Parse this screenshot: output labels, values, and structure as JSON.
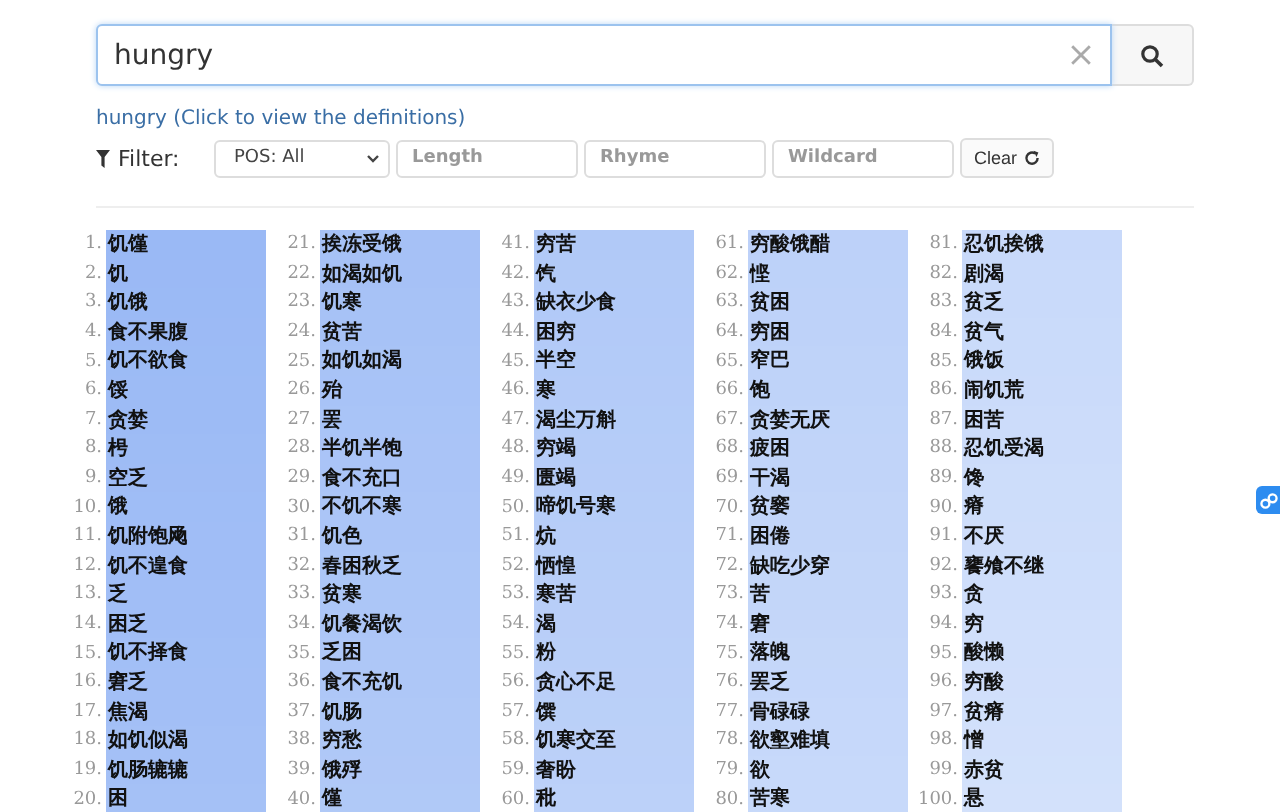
{
  "search": {
    "value": "hungry"
  },
  "definitions_link": "hungry (Click to view the definitions)",
  "filter": {
    "label": "Filter:",
    "pos": "POS: All",
    "fields": [
      {
        "placeholder": "Length"
      },
      {
        "placeholder": "Rhyme"
      },
      {
        "placeholder": "Wildcard"
      }
    ],
    "clear_button": "Clear"
  },
  "results": [
    {
      "number": "1.",
      "word": "饥馑"
    },
    {
      "number": "2.",
      "word": "饥"
    },
    {
      "number": "3.",
      "word": "饥饿"
    },
    {
      "number": "4.",
      "word": "食不果腹"
    },
    {
      "number": "5.",
      "word": "饥不欲食"
    },
    {
      "number": "6.",
      "word": "馁"
    },
    {
      "number": "7.",
      "word": "贪婪"
    },
    {
      "number": "8.",
      "word": "枵"
    },
    {
      "number": "9.",
      "word": "空乏"
    },
    {
      "number": "10.",
      "word": "饿"
    },
    {
      "number": "11.",
      "word": "饥附饱飏"
    },
    {
      "number": "12.",
      "word": "饥不遑食"
    },
    {
      "number": "13.",
      "word": "乏"
    },
    {
      "number": "14.",
      "word": "困乏"
    },
    {
      "number": "15.",
      "word": "饥不择食"
    },
    {
      "number": "16.",
      "word": "窘乏"
    },
    {
      "number": "17.",
      "word": "焦渴"
    },
    {
      "number": "18.",
      "word": "如饥似渴"
    },
    {
      "number": "19.",
      "word": "饥肠辘辘"
    },
    {
      "number": "20.",
      "word": "困"
    },
    {
      "number": "21.",
      "word": "挨冻受饿"
    },
    {
      "number": "22.",
      "word": "如渴如饥"
    },
    {
      "number": "23.",
      "word": "饥寒"
    },
    {
      "number": "24.",
      "word": "贫苦"
    },
    {
      "number": "25.",
      "word": "如饥如渴"
    },
    {
      "number": "26.",
      "word": "殆"
    },
    {
      "number": "27.",
      "word": "罢"
    },
    {
      "number": "28.",
      "word": "半饥半饱"
    },
    {
      "number": "29.",
      "word": "食不充口"
    },
    {
      "number": "30.",
      "word": "不饥不寒"
    },
    {
      "number": "31.",
      "word": "饥色"
    },
    {
      "number": "32.",
      "word": "春困秋乏"
    },
    {
      "number": "33.",
      "word": "贫寒"
    },
    {
      "number": "34.",
      "word": "饥餐渴饮"
    },
    {
      "number": "35.",
      "word": "乏困"
    },
    {
      "number": "36.",
      "word": "食不充饥"
    },
    {
      "number": "37.",
      "word": "饥肠"
    },
    {
      "number": "38.",
      "word": "穷愁"
    },
    {
      "number": "39.",
      "word": "饿殍"
    },
    {
      "number": "40.",
      "word": "馑"
    },
    {
      "number": "41.",
      "word": "穷苦"
    },
    {
      "number": "42.",
      "word": "饩"
    },
    {
      "number": "43.",
      "word": "缺衣少食"
    },
    {
      "number": "44.",
      "word": "困穷"
    },
    {
      "number": "45.",
      "word": "半空"
    },
    {
      "number": "46.",
      "word": "寒"
    },
    {
      "number": "47.",
      "word": "渴尘万斛"
    },
    {
      "number": "48.",
      "word": "穷竭"
    },
    {
      "number": "49.",
      "word": "匮竭"
    },
    {
      "number": "50.",
      "word": "啼饥号寒"
    },
    {
      "number": "51.",
      "word": "炕"
    },
    {
      "number": "52.",
      "word": "恓惶"
    },
    {
      "number": "53.",
      "word": "寒苦"
    },
    {
      "number": "54.",
      "word": "渴"
    },
    {
      "number": "55.",
      "word": "粉"
    },
    {
      "number": "56.",
      "word": "贪心不足"
    },
    {
      "number": "57.",
      "word": "馔"
    },
    {
      "number": "58.",
      "word": "饥寒交至"
    },
    {
      "number": "59.",
      "word": "奢盼"
    },
    {
      "number": "60.",
      "word": "秕"
    },
    {
      "number": "61.",
      "word": "穷酸饿醋"
    },
    {
      "number": "62.",
      "word": "悭"
    },
    {
      "number": "63.",
      "word": "贫困"
    },
    {
      "number": "64.",
      "word": "穷困"
    },
    {
      "number": "65.",
      "word": "窄巴"
    },
    {
      "number": "66.",
      "word": "饱"
    },
    {
      "number": "67.",
      "word": "贪婪无厌"
    },
    {
      "number": "68.",
      "word": "疲困"
    },
    {
      "number": "69.",
      "word": "干渴"
    },
    {
      "number": "70.",
      "word": "贫窭"
    },
    {
      "number": "71.",
      "word": "困倦"
    },
    {
      "number": "72.",
      "word": "缺吃少穿"
    },
    {
      "number": "73.",
      "word": "苦"
    },
    {
      "number": "74.",
      "word": "窘"
    },
    {
      "number": "75.",
      "word": "落魄"
    },
    {
      "number": "76.",
      "word": "罢乏"
    },
    {
      "number": "77.",
      "word": "骨碌碌"
    },
    {
      "number": "78.",
      "word": "欲壑难填"
    },
    {
      "number": "79.",
      "word": "欲"
    },
    {
      "number": "80.",
      "word": "苦寒"
    },
    {
      "number": "81.",
      "word": "忍饥挨饿"
    },
    {
      "number": "82.",
      "word": "剧渴"
    },
    {
      "number": "83.",
      "word": "贫乏"
    },
    {
      "number": "84.",
      "word": "贫气"
    },
    {
      "number": "85.",
      "word": "饿饭"
    },
    {
      "number": "86.",
      "word": "闹饥荒"
    },
    {
      "number": "87.",
      "word": "困苦"
    },
    {
      "number": "88.",
      "word": "忍饥受渴"
    },
    {
      "number": "89.",
      "word": "馋"
    },
    {
      "number": "90.",
      "word": "瘠"
    },
    {
      "number": "91.",
      "word": "不厌"
    },
    {
      "number": "92.",
      "word": "饔飧不继"
    },
    {
      "number": "93.",
      "word": "贪"
    },
    {
      "number": "94.",
      "word": "穷"
    },
    {
      "number": "95.",
      "word": "酸懒"
    },
    {
      "number": "96.",
      "word": "穷酸"
    },
    {
      "number": "97.",
      "word": "贫瘠"
    },
    {
      "number": "98.",
      "word": "憎"
    },
    {
      "number": "99.",
      "word": "赤贫"
    },
    {
      "number": "100.",
      "word": "悬"
    }
  ]
}
